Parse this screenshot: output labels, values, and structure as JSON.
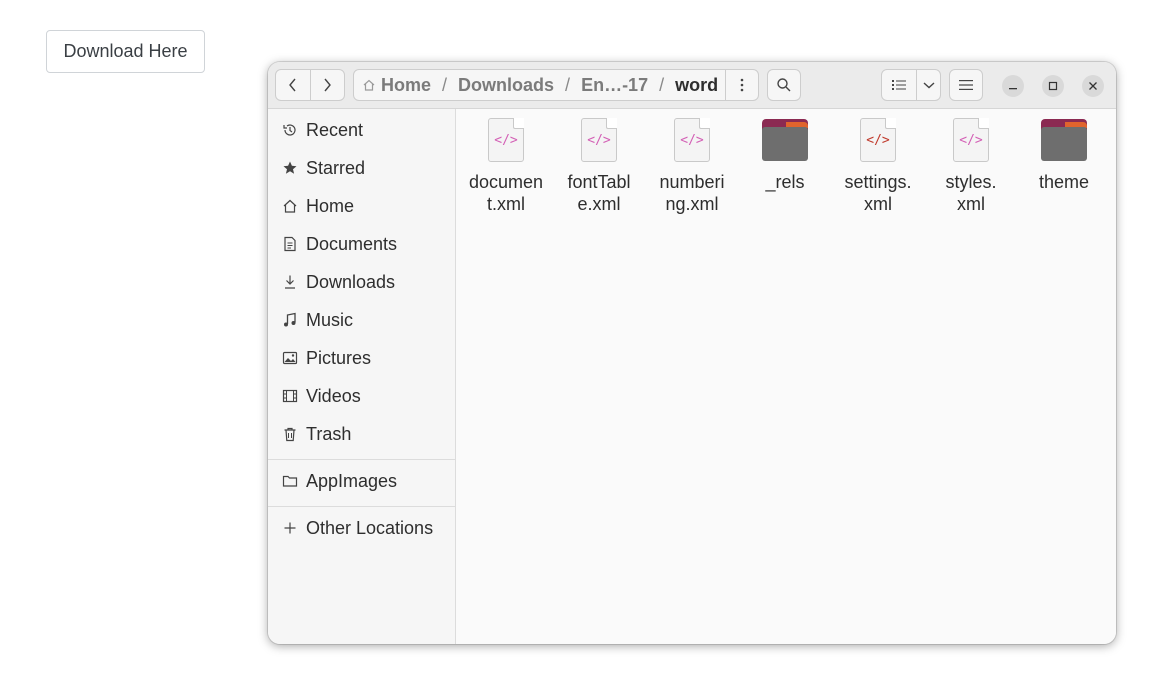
{
  "page": {
    "download_button": "Download Here"
  },
  "path": {
    "segments": [
      "Home",
      "Downloads",
      "En…-17",
      "word"
    ],
    "separator": "/"
  },
  "sidebar": {
    "items": [
      {
        "label": "Recent",
        "icon": "clock-icon"
      },
      {
        "label": "Starred",
        "icon": "star-icon"
      },
      {
        "label": "Home",
        "icon": "home-icon"
      },
      {
        "label": "Documents",
        "icon": "document-icon"
      },
      {
        "label": "Downloads",
        "icon": "download-icon"
      },
      {
        "label": "Music",
        "icon": "music-icon"
      },
      {
        "label": "Pictures",
        "icon": "picture-icon"
      },
      {
        "label": "Videos",
        "icon": "film-icon"
      },
      {
        "label": "Trash",
        "icon": "trash-icon"
      }
    ],
    "bookmarks": [
      {
        "label": "AppImages",
        "icon": "folder-icon"
      }
    ],
    "other": {
      "label": "Other Locations",
      "icon": "plus-icon"
    }
  },
  "files": [
    {
      "name": "documen\nt.xml",
      "type": "xml"
    },
    {
      "name": "fontTabl\ne.xml",
      "type": "xml"
    },
    {
      "name": "numberi\nng.xml",
      "type": "xml"
    },
    {
      "name": "_rels",
      "type": "folder"
    },
    {
      "name": "settings.\nxml",
      "type": "xml-red"
    },
    {
      "name": "styles.\nxml",
      "type": "xml"
    },
    {
      "name": "theme",
      "type": "folder"
    }
  ],
  "colors": {
    "accent": "#e0642d",
    "folder_back": "#8b2a52",
    "folder_front": "#6e6e6e",
    "xml_code": "#d35fb5"
  }
}
